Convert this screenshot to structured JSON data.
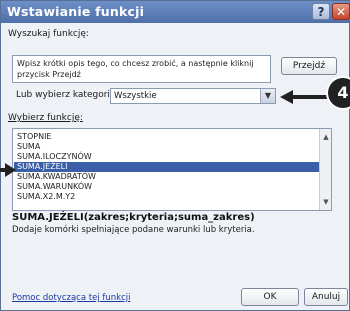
{
  "window": {
    "title": "Wstawianie funkcji",
    "help_glyph": "?",
    "close_glyph": "✕"
  },
  "search": {
    "label": "Wyszukaj funkcję:",
    "value": "Wpisz krótki opis tego, co chcesz zrobić, a następnie kliknij przycisk Przejdź",
    "go_button": "Przejdź"
  },
  "category": {
    "label": "Lub wybierz kategorię:",
    "value": "Wszystkie"
  },
  "functions": {
    "label": "Wybierz funkcję:",
    "items": [
      "STOPNIE",
      "SUMA",
      "SUMA.ILOCZYNÓW",
      "SUMA.JEŻELI",
      "SUMA.KWADRATÓW",
      "SUMA.WARUNKÓW",
      "SUMA.X2.M.Y2"
    ],
    "selected_index": 3
  },
  "syntax": "SUMA.JEŻELI(zakres;kryteria;suma_zakres)",
  "description": "Dodaje komórki spełniające podane warunki lub kryteria.",
  "footer": {
    "help_link": "Pomoc dotycząca tej funkcji",
    "ok": "OK",
    "cancel": "Anuluj"
  },
  "callout": {
    "number": "4"
  },
  "icons": [
    "help-icon",
    "close-icon",
    "chevron-down-icon",
    "scroll-up-icon",
    "scroll-down-icon",
    "callout-arrow-icon"
  ],
  "colors": {
    "titlebar": "#5a7ab5",
    "selection": "#3a5fa8",
    "close": "#c3452b"
  }
}
